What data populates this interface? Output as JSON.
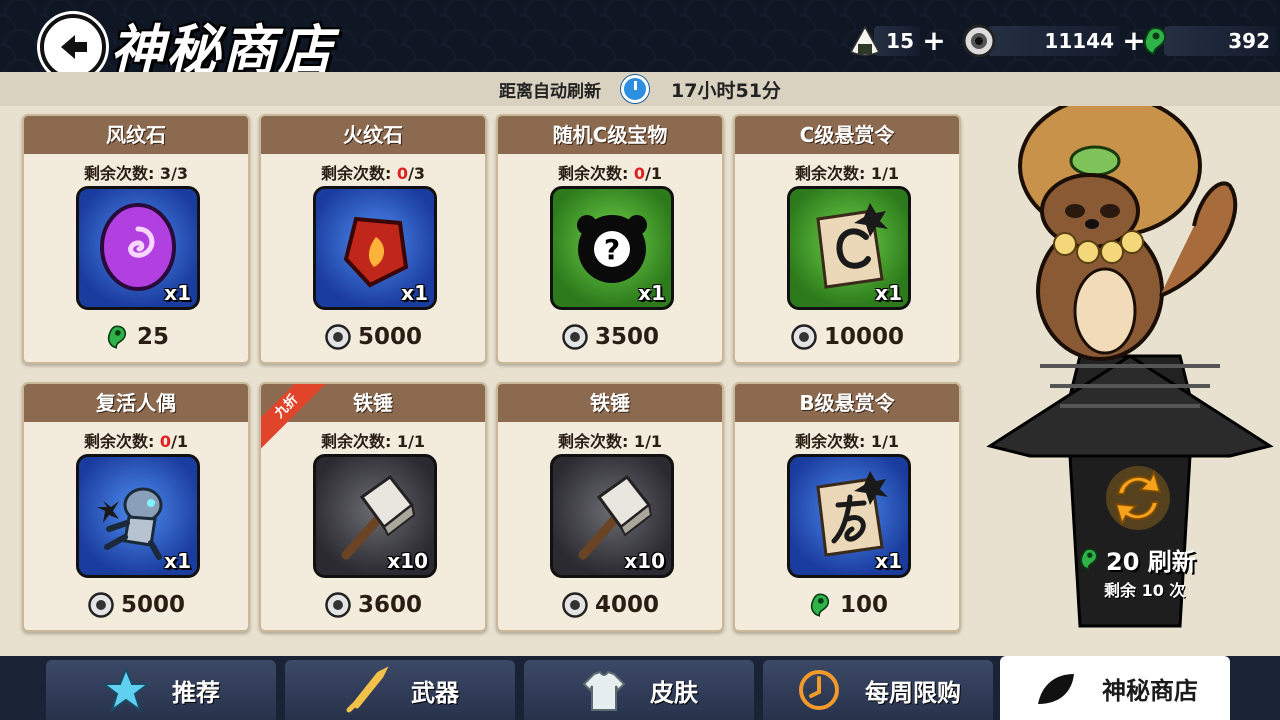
{
  "header": {
    "title": "神秘商店",
    "refresh_label": "距离自动刷新",
    "refresh_time": "17小时51分"
  },
  "currencies": [
    {
      "icon": "rice-ball-icon",
      "value": "15"
    },
    {
      "icon": "coin-icon",
      "value": "11144"
    },
    {
      "icon": "magatama-icon",
      "value": "392"
    }
  ],
  "remain_prefix": "剩余次数: ",
  "items": [
    {
      "name": "风纹石",
      "used": "3",
      "total": "/3",
      "used_red": false,
      "qty": "x1",
      "price": "25",
      "currency": "magatama-icon",
      "icon": "wind-stone-icon",
      "bg": "blue"
    },
    {
      "name": "火纹石",
      "used": "0",
      "total": "/3",
      "used_red": true,
      "qty": "x1",
      "price": "5000",
      "currency": "coin-icon",
      "icon": "fire-stone-icon",
      "bg": "blue"
    },
    {
      "name": "随机C级宝物",
      "used": "0",
      "total": "/1",
      "used_red": true,
      "qty": "x1",
      "price": "3500",
      "currency": "coin-icon",
      "icon": "mystery-treasure-icon",
      "bg": "green"
    },
    {
      "name": "C级悬赏令",
      "used": "1",
      "total": "/1",
      "used_red": false,
      "qty": "x1",
      "price": "10000",
      "currency": "coin-icon",
      "icon": "bounty-c-scroll-icon",
      "bg": "green"
    },
    {
      "name": "复活人偶",
      "used": "0",
      "total": "/1",
      "used_red": true,
      "qty": "x1",
      "price": "5000",
      "currency": "coin-icon",
      "icon": "revive-doll-icon",
      "bg": "blue"
    },
    {
      "name": "铁锤",
      "used": "1",
      "total": "/1",
      "used_red": false,
      "qty": "x10",
      "price": "3600",
      "currency": "coin-icon",
      "icon": "hammer-icon",
      "bg": "gray",
      "discount": "九折"
    },
    {
      "name": "铁锤",
      "used": "1",
      "total": "/1",
      "used_red": false,
      "qty": "x10",
      "price": "4000",
      "currency": "coin-icon",
      "icon": "hammer-icon",
      "bg": "gray"
    },
    {
      "name": "B级悬赏令",
      "used": "1",
      "total": "/1",
      "used_red": false,
      "qty": "x1",
      "price": "100",
      "currency": "magatama-icon",
      "icon": "bounty-b-scroll-icon",
      "bg": "blue"
    }
  ],
  "refresh": {
    "cost": "20 刷新",
    "remaining": "剩余 10 次"
  },
  "tabs": [
    {
      "label": "推荐",
      "icon": "star-icon"
    },
    {
      "label": "武器",
      "icon": "sword-icon"
    },
    {
      "label": "皮肤",
      "icon": "shirt-icon"
    },
    {
      "label": "每周限购",
      "icon": "weekly-clock-icon"
    },
    {
      "label": "神秘商店",
      "icon": "leaf-icon",
      "active": true
    }
  ],
  "colors": {
    "header_bg": "#0f1624",
    "card_header": "#8c6a4f",
    "used_red": "#e02121",
    "tab_bg": "#3c4966",
    "magatama_green": "#2fb24a"
  }
}
